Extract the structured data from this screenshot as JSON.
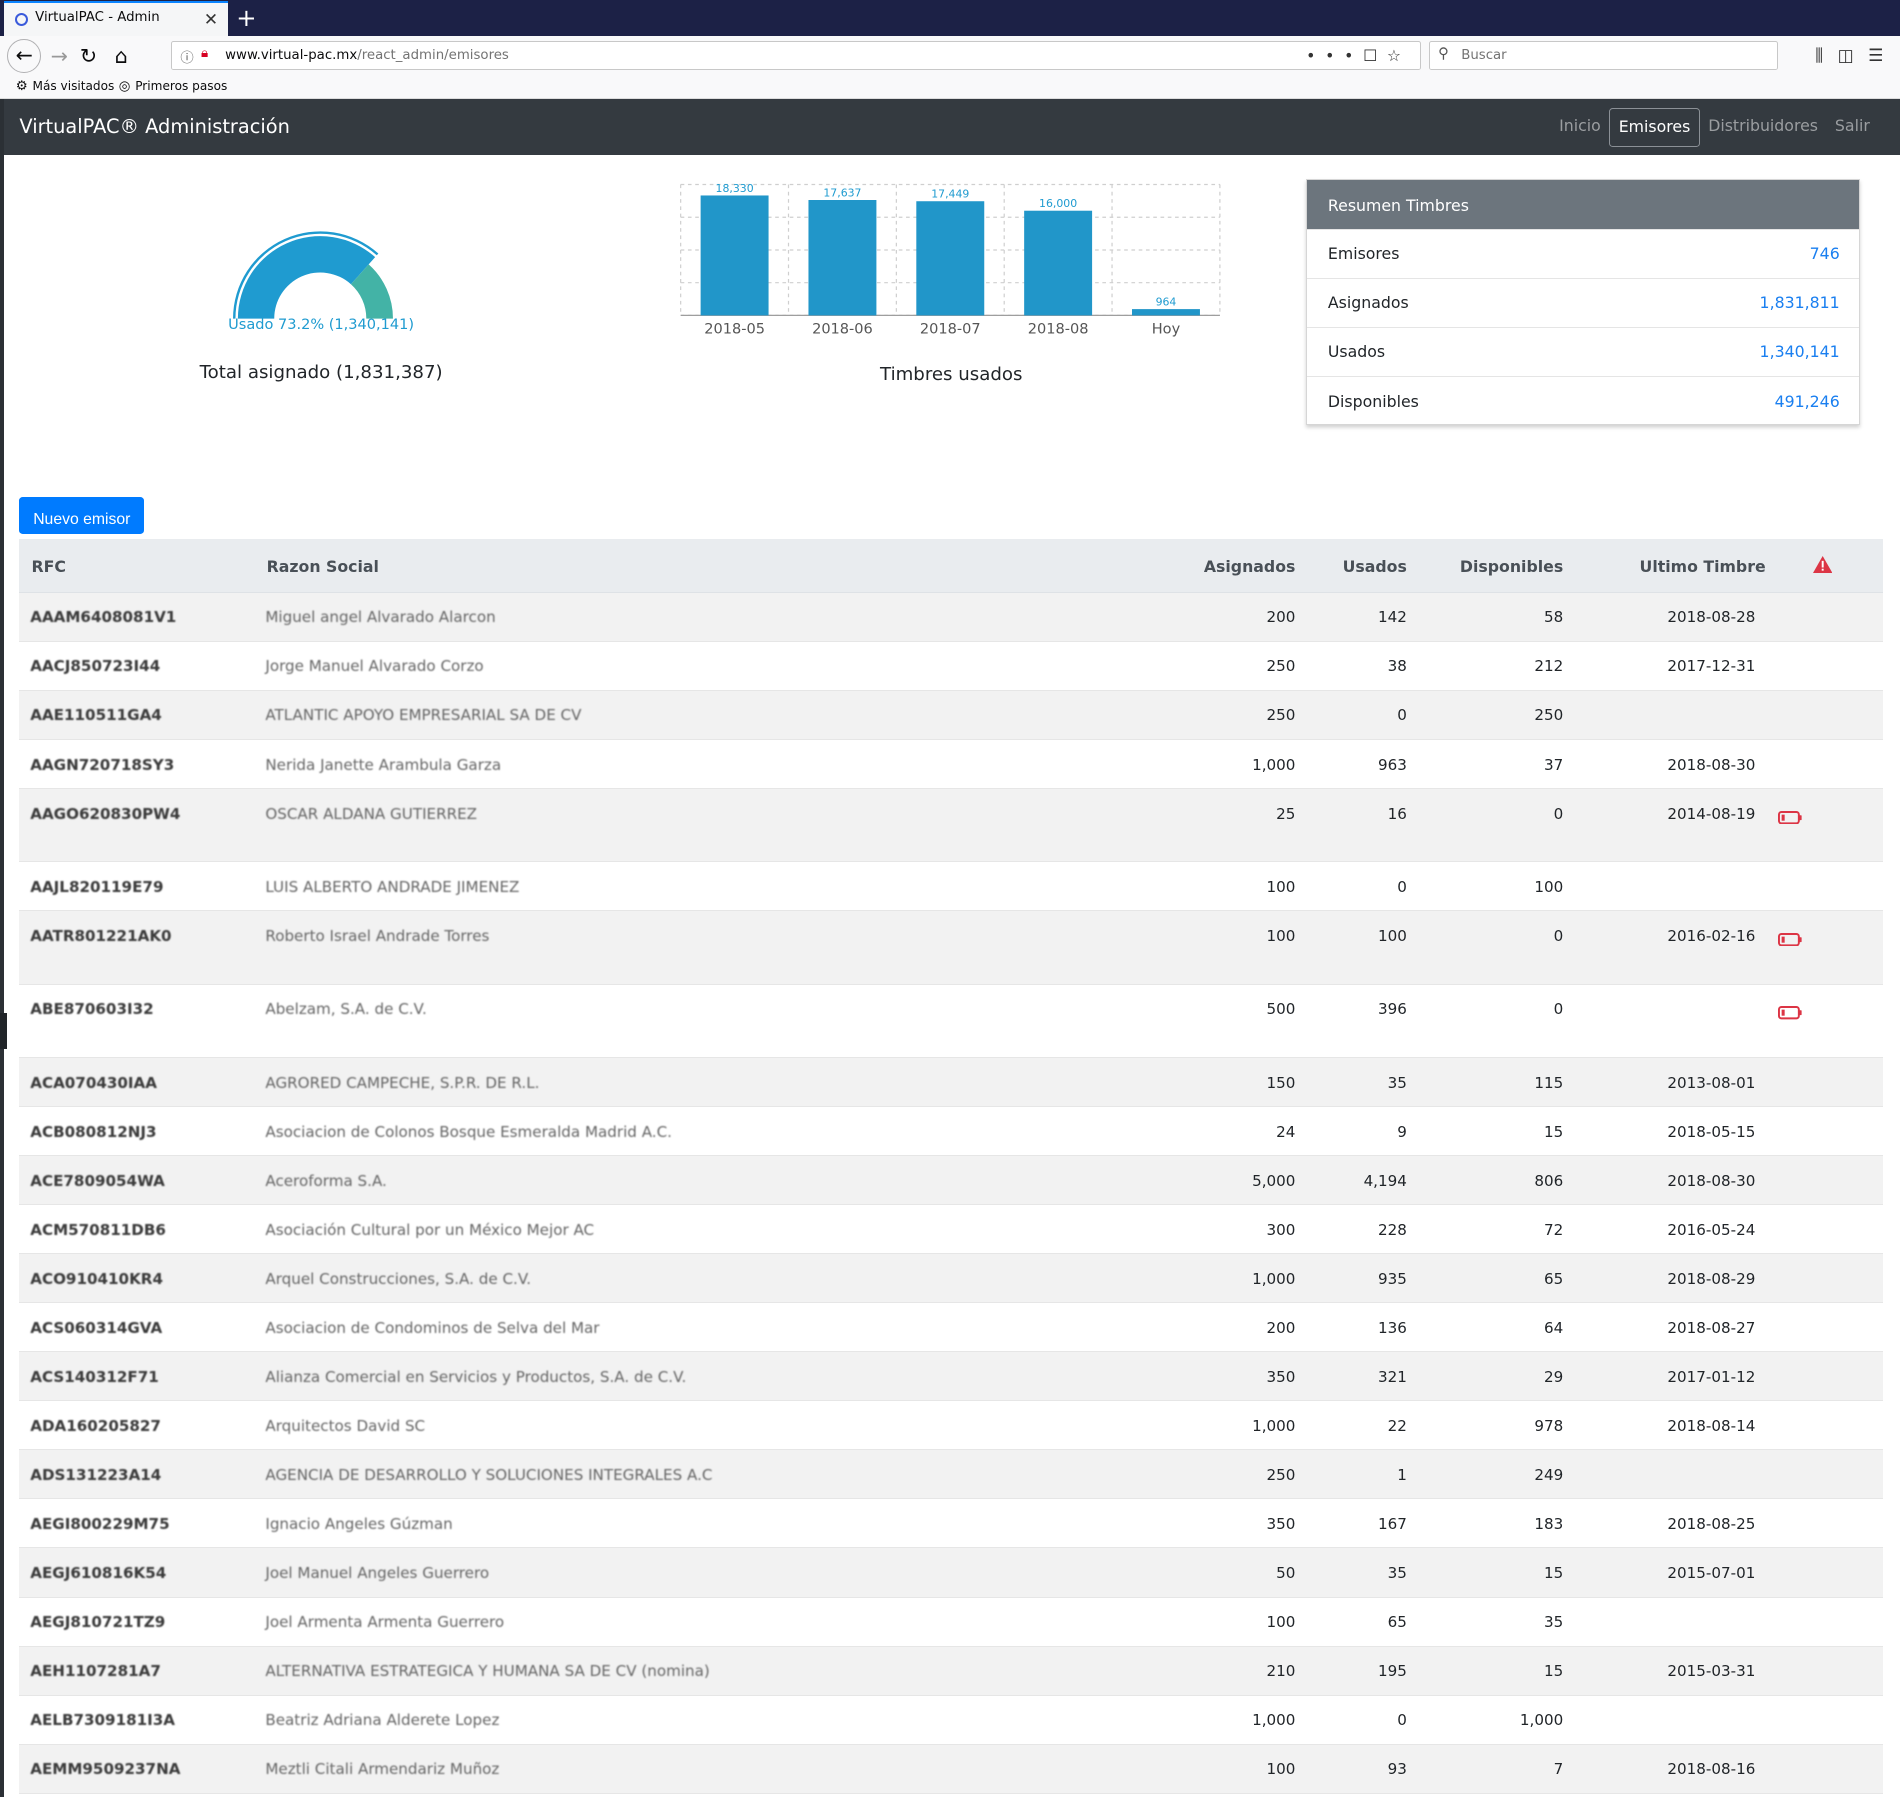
{
  "browser": {
    "tab_title": "VirtualPAC - Admin",
    "url_domain": "www.virtual-pac.mx",
    "url_path": "/react_admin/emisores",
    "search_placeholder": "Buscar",
    "bookmarks": [
      "Más visitados",
      "Primeros pasos"
    ]
  },
  "app": {
    "brand": "VirtualPAC® Administración",
    "nav": [
      "Inicio",
      "Emisores",
      "Distribuidores",
      "Salir"
    ],
    "active_nav": "Emisores"
  },
  "gauge": {
    "used_label": "Usado 73.2% (1,340,141)",
    "title": "Total asignado (1,831,387)",
    "used_fraction": 0.732,
    "colors": {
      "used": "#1f9bd0",
      "free": "#43b3a6"
    }
  },
  "chart_data": {
    "type": "bar",
    "categories": [
      "2018-05",
      "2018-06",
      "2018-07",
      "2018-08",
      "Hoy"
    ],
    "values": [
      18330,
      17637,
      17449,
      16000,
      964
    ],
    "value_labels": [
      "18,330",
      "17,637",
      "17,449",
      "16,000",
      "964"
    ],
    "title": "Timbres usados",
    "xlabel": "",
    "ylabel": "",
    "ylim": [
      0,
      20000
    ],
    "grid": true,
    "bar_color": "#2196c9"
  },
  "summary": {
    "title": "Resumen Timbres",
    "rows": [
      {
        "label": "Emisores",
        "value": "746"
      },
      {
        "label": "Asignados",
        "value": "1,831,811"
      },
      {
        "label": "Usados",
        "value": "1,340,141"
      },
      {
        "label": "Disponibles",
        "value": "491,246"
      }
    ]
  },
  "new_button": "Nuevo emisor",
  "table": {
    "headers": {
      "rfc": "RFC",
      "razon": "Razon Social",
      "asignados": "Asignados",
      "usados": "Usados",
      "disponibles": "Disponibles",
      "ultimo": "Ultimo Timbre"
    },
    "rows": [
      {
        "rfc": "AAAM6408081V1",
        "razon": "Miguel angel Alvarado Alarcon",
        "asignados": "200",
        "usados": "142",
        "disponibles": "58",
        "ultimo": "2018-08-28",
        "alert": false
      },
      {
        "rfc": "AACJ850723I44",
        "razon": "Jorge Manuel Alvarado Corzo",
        "asignados": "250",
        "usados": "38",
        "disponibles": "212",
        "ultimo": "2017-12-31",
        "alert": false
      },
      {
        "rfc": "AAE110511GA4",
        "razon": "ATLANTIC APOYO EMPRESARIAL SA DE CV",
        "asignados": "250",
        "usados": "0",
        "disponibles": "250",
        "ultimo": "",
        "alert": false
      },
      {
        "rfc": "AAGN720718SY3",
        "razon": "Nerida Janette Arambula Garza",
        "asignados": "1,000",
        "usados": "963",
        "disponibles": "37",
        "ultimo": "2018-08-30",
        "alert": false
      },
      {
        "rfc": "AAGO620830PW4",
        "razon": "OSCAR ALDANA GUTIERREZ",
        "asignados": "25",
        "usados": "16",
        "disponibles": "0",
        "ultimo": "2014-08-19",
        "alert": true
      },
      {
        "rfc": "AAJL820119E79",
        "razon": "LUIS ALBERTO ANDRADE JIMENEZ",
        "asignados": "100",
        "usados": "0",
        "disponibles": "100",
        "ultimo": "",
        "alert": false
      },
      {
        "rfc": "AATR801221AK0",
        "razon": "Roberto Israel Andrade Torres",
        "asignados": "100",
        "usados": "100",
        "disponibles": "0",
        "ultimo": "2016-02-16",
        "alert": true
      },
      {
        "rfc": "ABE870603I32",
        "razon": "Abelzam, S.A. de C.V.",
        "asignados": "500",
        "usados": "396",
        "disponibles": "0",
        "ultimo": "",
        "alert": true
      },
      {
        "rfc": "ACA070430IAA",
        "razon": "AGRORED CAMPECHE, S.P.R. DE R.L.",
        "asignados": "150",
        "usados": "35",
        "disponibles": "115",
        "ultimo": "2013-08-01",
        "alert": false
      },
      {
        "rfc": "ACB080812NJ3",
        "razon": "Asociacion de Colonos Bosque Esmeralda Madrid A.C.",
        "asignados": "24",
        "usados": "9",
        "disponibles": "15",
        "ultimo": "2018-05-15",
        "alert": false
      },
      {
        "rfc": "ACE7809054WA",
        "razon": "Aceroforma S.A.",
        "asignados": "5,000",
        "usados": "4,194",
        "disponibles": "806",
        "ultimo": "2018-08-30",
        "alert": false
      },
      {
        "rfc": "ACM570811DB6",
        "razon": "Asociación Cultural por un México Mejor AC",
        "asignados": "300",
        "usados": "228",
        "disponibles": "72",
        "ultimo": "2016-05-24",
        "alert": false
      },
      {
        "rfc": "ACO910410KR4",
        "razon": "Arquel Construcciones, S.A. de C.V.",
        "asignados": "1,000",
        "usados": "935",
        "disponibles": "65",
        "ultimo": "2018-08-29",
        "alert": false
      },
      {
        "rfc": "ACS060314GVA",
        "razon": "Asociacion de Condominos de Selva del Mar",
        "asignados": "200",
        "usados": "136",
        "disponibles": "64",
        "ultimo": "2018-08-27",
        "alert": false
      },
      {
        "rfc": "ACS140312F71",
        "razon": "Alianza Comercial en Servicios y Productos, S.A. de C.V.",
        "asignados": "350",
        "usados": "321",
        "disponibles": "29",
        "ultimo": "2017-01-12",
        "alert": false
      },
      {
        "rfc": "ADA160205827",
        "razon": "Arquitectos David SC",
        "asignados": "1,000",
        "usados": "22",
        "disponibles": "978",
        "ultimo": "2018-08-14",
        "alert": false
      },
      {
        "rfc": "ADS131223A14",
        "razon": "AGENCIA DE DESARROLLO Y SOLUCIONES INTEGRALES A.C",
        "asignados": "250",
        "usados": "1",
        "disponibles": "249",
        "ultimo": "",
        "alert": false
      },
      {
        "rfc": "AEGI800229M75",
        "razon": "Ignacio Angeles Gúzman",
        "asignados": "350",
        "usados": "167",
        "disponibles": "183",
        "ultimo": "2018-08-25",
        "alert": false
      },
      {
        "rfc": "AEGJ610816K54",
        "razon": "Joel Manuel Angeles Guerrero",
        "asignados": "50",
        "usados": "35",
        "disponibles": "15",
        "ultimo": "2015-07-01",
        "alert": false
      },
      {
        "rfc": "AEGJ810721TZ9",
        "razon": "Joel Armenta Armenta Guerrero",
        "asignados": "100",
        "usados": "65",
        "disponibles": "35",
        "ultimo": "",
        "alert": false
      },
      {
        "rfc": "AEH1107281A7",
        "razon": "ALTERNATIVA ESTRATEGICA Y HUMANA SA DE CV (nomina)",
        "asignados": "210",
        "usados": "195",
        "disponibles": "15",
        "ultimo": "2015-03-31",
        "alert": false
      },
      {
        "rfc": "AELB7309181I3A",
        "razon": "Beatriz Adriana Alderete Lopez",
        "asignados": "1,000",
        "usados": "0",
        "disponibles": "1,000",
        "ultimo": "",
        "alert": false
      },
      {
        "rfc": "AEMM9509237NA",
        "razon": "Meztli Citali Armendariz Muñoz",
        "asignados": "100",
        "usados": "93",
        "disponibles": "7",
        "ultimo": "2018-08-16",
        "alert": false
      }
    ]
  }
}
